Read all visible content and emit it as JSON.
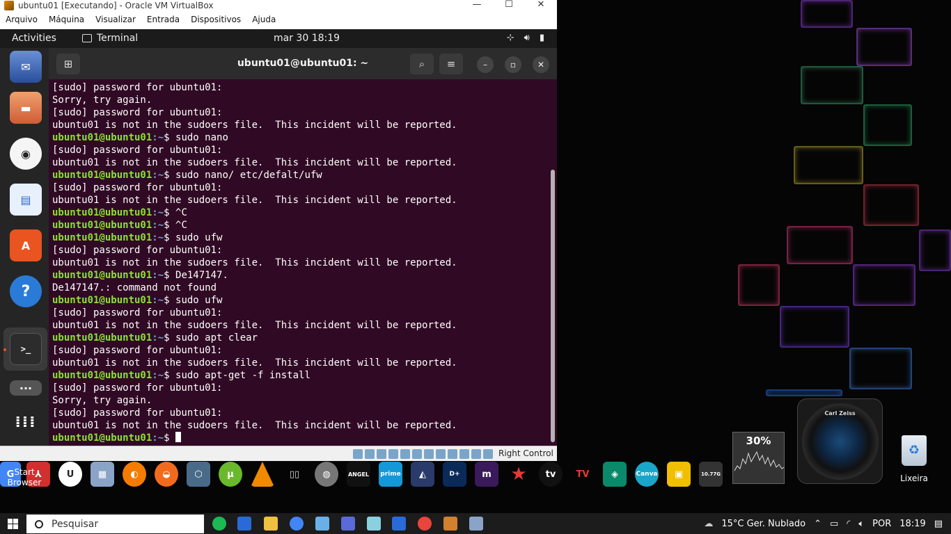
{
  "vbox": {
    "title": "ubuntu01 [Executando] - Oracle VM VirtualBox",
    "menu": [
      "Arquivo",
      "Máquina",
      "Visualizar",
      "Entrada",
      "Dispositivos",
      "Ajuda"
    ],
    "controls": {
      "minimize": "—",
      "maximize": "☐",
      "close": "✕"
    },
    "status": {
      "host_key": "Right Control"
    }
  },
  "ubuntu": {
    "activities": "Activities",
    "app_name": "Terminal",
    "clock": "mar 30  18:19"
  },
  "terminal": {
    "title": "ubuntu01@ubuntu01: ~",
    "prompt_user": "ubuntu01@ubuntu01",
    "prompt_sep": ":~",
    "lines": [
      {
        "type": "out",
        "text": "[sudo] password for ubuntu01:"
      },
      {
        "type": "out",
        "text": "Sorry, try again."
      },
      {
        "type": "out",
        "text": "[sudo] password for ubuntu01:"
      },
      {
        "type": "out",
        "text": "ubuntu01 is not in the sudoers file.  This incident will be reported."
      },
      {
        "type": "cmd",
        "text": "$ sudo nano"
      },
      {
        "type": "out",
        "text": "[sudo] password for ubuntu01:"
      },
      {
        "type": "out",
        "text": "ubuntu01 is not in the sudoers file.  This incident will be reported."
      },
      {
        "type": "cmd",
        "text": "$ sudo nano/ etc/defalt/ufw"
      },
      {
        "type": "out",
        "text": "[sudo] password for ubuntu01:"
      },
      {
        "type": "out",
        "text": "ubuntu01 is not in the sudoers file.  This incident will be reported."
      },
      {
        "type": "cmd",
        "text": "$ ^C"
      },
      {
        "type": "cmd",
        "text": "$ ^C"
      },
      {
        "type": "cmd",
        "text": "$ sudo ufw"
      },
      {
        "type": "out",
        "text": "[sudo] password for ubuntu01:"
      },
      {
        "type": "out",
        "text": "ubuntu01 is not in the sudoers file.  This incident will be reported."
      },
      {
        "type": "cmd",
        "text": "$ De147147."
      },
      {
        "type": "out",
        "text": "De147147.: command not found"
      },
      {
        "type": "cmd",
        "text": "$ sudo ufw"
      },
      {
        "type": "out",
        "text": "[sudo] password for ubuntu01:"
      },
      {
        "type": "out",
        "text": "ubuntu01 is not in the sudoers file.  This incident will be reported."
      },
      {
        "type": "cmd",
        "text": "$ sudo apt clear"
      },
      {
        "type": "out",
        "text": "[sudo] password for ubuntu01:"
      },
      {
        "type": "out",
        "text": "ubuntu01 is not in the sudoers file.  This incident will be reported."
      },
      {
        "type": "cmd",
        "text": "$ sudo apt-get -f install"
      },
      {
        "type": "out",
        "text": "[sudo] password for ubuntu01:"
      },
      {
        "type": "out",
        "text": "Sorry, try again."
      },
      {
        "type": "out",
        "text": "[sudo] password for ubuntu01:"
      },
      {
        "type": "out",
        "text": "ubuntu01 is not in the sudoers file.  This incident will be reported."
      },
      {
        "type": "cmd",
        "text": "$ "
      }
    ]
  },
  "desktop": {
    "start_browser_label": "Start\nBrowser",
    "cpu_percent": "30%",
    "lens_brand": "Carl Zeiss",
    "recycle_label": "Lixeira",
    "tray_tiny_value": "10.77G"
  },
  "taskbar": {
    "search_placeholder": "Pesquisar",
    "weather": "15°C  Ger. Nublado",
    "language": "POR",
    "time": "18:19"
  },
  "colors": {
    "terminal_bg": "#300a24",
    "prompt_green": "#8ae234",
    "prompt_blue": "#729fcf"
  }
}
